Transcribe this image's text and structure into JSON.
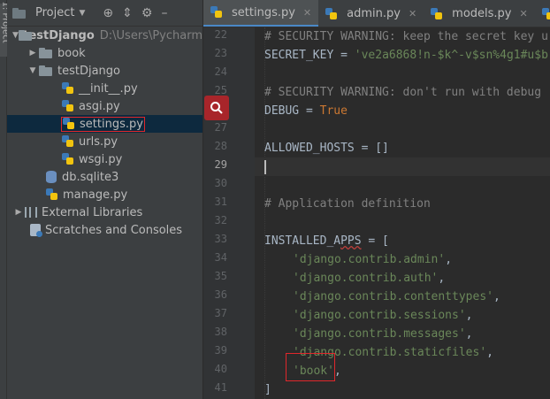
{
  "sidebar_strip": {
    "label": "1: Project"
  },
  "project_panel": {
    "title": "Project",
    "tree": [
      {
        "label": "testDjango",
        "path": "D:\\Users\\Pycharm"
      },
      {
        "label": "book"
      },
      {
        "label": "testDjango"
      },
      {
        "label": "__init__.py"
      },
      {
        "label": "asgi.py"
      },
      {
        "label": "settings.py"
      },
      {
        "label": "urls.py"
      },
      {
        "label": "wsgi.py"
      },
      {
        "label": "db.sqlite3"
      },
      {
        "label": "manage.py"
      },
      {
        "label": "External Libraries"
      },
      {
        "label": "Scratches and Consoles"
      }
    ]
  },
  "editor": {
    "tabs": [
      {
        "label": "settings.py",
        "active": true
      },
      {
        "label": "admin.py"
      },
      {
        "label": "models.py"
      },
      {
        "label": "0001_in"
      }
    ],
    "line_numbers": [
      "22",
      "23",
      "24",
      "25",
      "26",
      "27",
      "28",
      "29",
      "30",
      "31",
      "32",
      "33",
      "34",
      "35",
      "36",
      "37",
      "38",
      "39",
      "40",
      "41"
    ],
    "current_line": "29",
    "code": {
      "l22": "# SECURITY WARNING: keep the secret key u",
      "l23_key": "SECRET_KEY",
      "l23_eq": " = ",
      "l23_val": "'ve2a6868!n-$k^-v$sn%4g1#u$b",
      "l25": "# SECURITY WARNING: don't run with debug",
      "l26_key": "DEBUG",
      "l26_eq": " = ",
      "l26_val": "True",
      "l28": "ALLOWED_HOSTS = []",
      "l31": "# Application definition",
      "l33_a": "INSTALLED_A",
      "l33_b": "PPS",
      "l33_c": " = [",
      "l34": "'django.contrib.admin'",
      "l35": "'django.contrib.auth'",
      "l36": "'django.contrib.contenttypes'",
      "l37": "'django.contrib.sessions'",
      "l38": "'django.contrib.messages'",
      "l39": "'django.contrib.staticfiles'",
      "l40": "'book'",
      "comma": ",",
      "l41": "]"
    }
  },
  "colors": {
    "accent": "#4a88c7",
    "highlight_red": "#e0272b",
    "string": "#6a8759",
    "keyword": "#cc7832",
    "comment": "#808080"
  }
}
